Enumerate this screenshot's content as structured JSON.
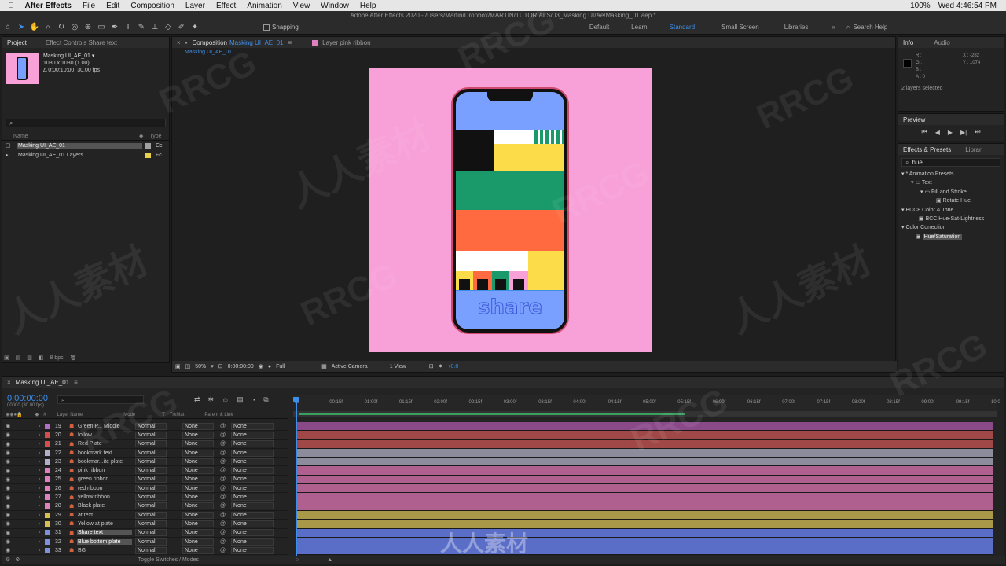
{
  "menubar": {
    "apple": "",
    "app": "After Effects",
    "items": [
      "File",
      "Edit",
      "Composition",
      "Layer",
      "Effect",
      "Animation",
      "View",
      "Window",
      "Help"
    ],
    "battery": "100%",
    "clock": "Wed 4:46:54 PM"
  },
  "app_title": "Adobe After Effects 2020 - /Users/Martin/Dropbox/MARTIN/TUTORIALS/03_Masking UI/Ae/Masking_01.aep *",
  "toolbar": {
    "snapping": "Snapping",
    "workspaces": [
      "Default",
      "Learn",
      "Standard",
      "Small Screen",
      "Libraries"
    ],
    "active_workspace": "Standard",
    "search_help": "Search Help"
  },
  "project": {
    "tab": "Project",
    "tab2": "Effect Controls Share text",
    "comp_name": "Masking UI_AE_01 ▾",
    "comp_size": "1080 x 1080 (1.00)",
    "comp_dur": "Δ 0:00:10:00, 30.00 fps",
    "col_name": "Name",
    "col_type": "Type",
    "items": [
      {
        "name": "Masking UI_AE_01",
        "type": "Cc",
        "color": "#a0a0a0",
        "selected": true
      },
      {
        "name": "Masking UI_AE_01 Layers",
        "type": "Fc",
        "color": "#e8d04a",
        "selected": false
      }
    ],
    "bpc": "8 bpc"
  },
  "comp": {
    "tab": "Composition",
    "tab_name": "Masking UI_AE_01",
    "layer_tab": "Layer pink ribbon",
    "sub_tab": "Masking UI_AE_01",
    "zoom": "50%",
    "time": "0:00:00:00",
    "quality": "Full",
    "camera": "Active Camera",
    "view": "1 View",
    "exposure": "+0.0",
    "share_text": "share"
  },
  "info": {
    "tab": "Info",
    "tab2": "Audio",
    "r": "R :",
    "g": "G :",
    "b": "B :",
    "a": "A :  0",
    "x": "X : -282",
    "y": "Y : 1074",
    "status": "2 layers selected"
  },
  "preview": {
    "tab": "Preview"
  },
  "effects": {
    "tab": "Effects & Presets",
    "tab2": "Librari",
    "search": "hue",
    "tree": [
      "* Animation Presets",
      "Text",
      "Fill and Stroke",
      "Rotate Hue",
      "BCC8 Color & Tone",
      "BCC Hue-Sat-Lightness",
      "Color Correction",
      "Hue/Saturation"
    ]
  },
  "timeline": {
    "tab": "Masking UI_AE_01",
    "timecode": "0:00:00:00",
    "frames": "00000 (30.00 fps)",
    "col_hash": "#",
    "col_layer": "Layer Name",
    "col_mode": "Mode",
    "col_t": "T",
    "col_trk": "TrkMat",
    "col_parent": "Parent & Link",
    "ruler": [
      "0f",
      "00:15f",
      "01:00f",
      "01:15f",
      "02:00f",
      "02:15f",
      "03:00f",
      "03:15f",
      "04:00f",
      "04:15f",
      "05:00f",
      "05:15f",
      "06:00f",
      "06:15f",
      "07:00f",
      "07:15f",
      "08:00f",
      "08:15f",
      "09:00f",
      "09:15f",
      "10:0"
    ],
    "footer": "Toggle Switches / Modes",
    "layers": [
      {
        "num": "19",
        "name": "Green P... Middle",
        "color": "#b070c8",
        "bar": "#8a4a8a",
        "eye": true
      },
      {
        "num": "20",
        "name": "follow",
        "color": "#d05050",
        "bar": "#a04848",
        "eye": true
      },
      {
        "num": "21",
        "name": "Red Plate",
        "color": "#d05050",
        "bar": "#a04848",
        "eye": true
      },
      {
        "num": "22",
        "name": "bookmark text",
        "color": "#b0b0c8",
        "bar": "#8c8c9c",
        "eye": true
      },
      {
        "num": "23",
        "name": "bookmar...ite plate",
        "color": "#b0b0c8",
        "bar": "#8c8c9c",
        "eye": true
      },
      {
        "num": "24",
        "name": "pink ribbon",
        "color": "#e080c0",
        "bar": "#b0608e",
        "eye": true
      },
      {
        "num": "25",
        "name": "green ribbon",
        "color": "#e080c0",
        "bar": "#b0608e",
        "eye": true
      },
      {
        "num": "26",
        "name": "red ribbon",
        "color": "#e080c0",
        "bar": "#b0608e",
        "eye": true
      },
      {
        "num": "27",
        "name": "yellow ribbon",
        "color": "#e080c0",
        "bar": "#b0608e",
        "eye": true
      },
      {
        "num": "28",
        "name": "Black plate",
        "color": "#e080c0",
        "bar": "#b0608e",
        "eye": true
      },
      {
        "num": "29",
        "name": "at text",
        "color": "#d8c050",
        "bar": "#a89848",
        "eye": true
      },
      {
        "num": "30",
        "name": "Yellow at plate",
        "color": "#d8c050",
        "bar": "#a89848",
        "eye": true
      },
      {
        "num": "31",
        "name": "Share text",
        "color": "#8090e0",
        "bar": "#5a6ec8",
        "eye": true
      },
      {
        "num": "32",
        "name": "Blue bottom plate",
        "color": "#8090e0",
        "bar": "#5a6ec8",
        "eye": true
      },
      {
        "num": "33",
        "name": "BG",
        "color": "#8090e0",
        "bar": "#5a6ec8",
        "eye": true
      }
    ],
    "mode_value": "Normal",
    "trk_value": "None",
    "parent_value": "None"
  },
  "watermark": {
    "a": "RRCG",
    "b": "人人素材"
  },
  "colors": {
    "accent": "#3d8ee8",
    "pink_bg": "#f8a0d8",
    "phone_blue": "#7aa0ff"
  }
}
